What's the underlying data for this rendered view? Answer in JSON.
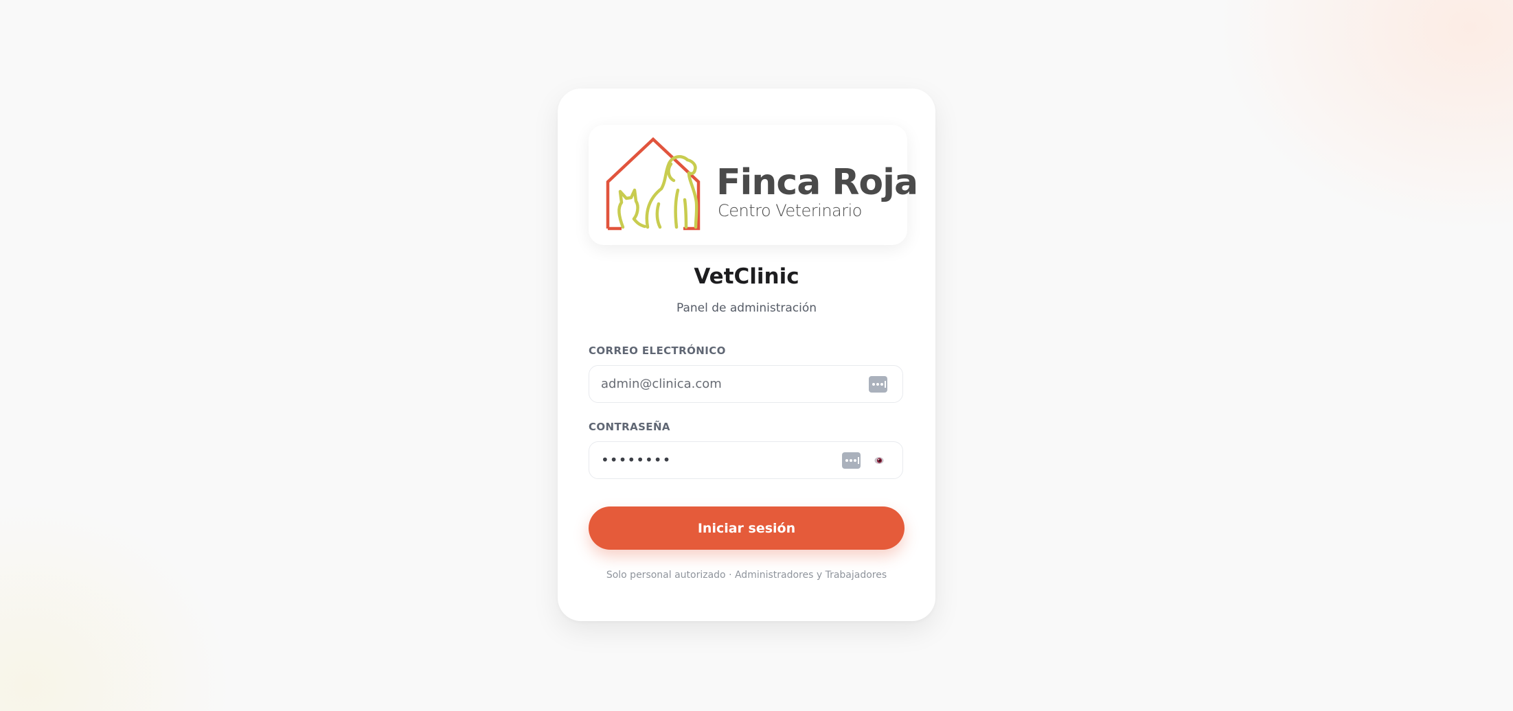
{
  "brand": {
    "name": "Finca Roja",
    "tagline": "Centro Veterinario",
    "colors": {
      "house": "#e1543d",
      "animals": "#c8cc4f",
      "text": "#4a4a4a"
    }
  },
  "app": {
    "title": "VetClinic",
    "subtitle": "Panel de administración"
  },
  "form": {
    "email": {
      "label": "CORREO ELECTRÓNICO",
      "value": "admin@clinica.com",
      "autofill_icon": "password-manager-icon"
    },
    "password": {
      "label": "CONTRASEÑA",
      "value": "••••••••",
      "autofill_icon": "password-manager-icon",
      "toggle_icon": "eye-icon"
    },
    "submit_label": "Iniciar sesión"
  },
  "footer": {
    "note": "Solo personal autorizado · Administradores y Trabajadores"
  },
  "theme": {
    "accent": "#e55b3a",
    "background": "#f9f9f9",
    "card": "#ffffff"
  }
}
